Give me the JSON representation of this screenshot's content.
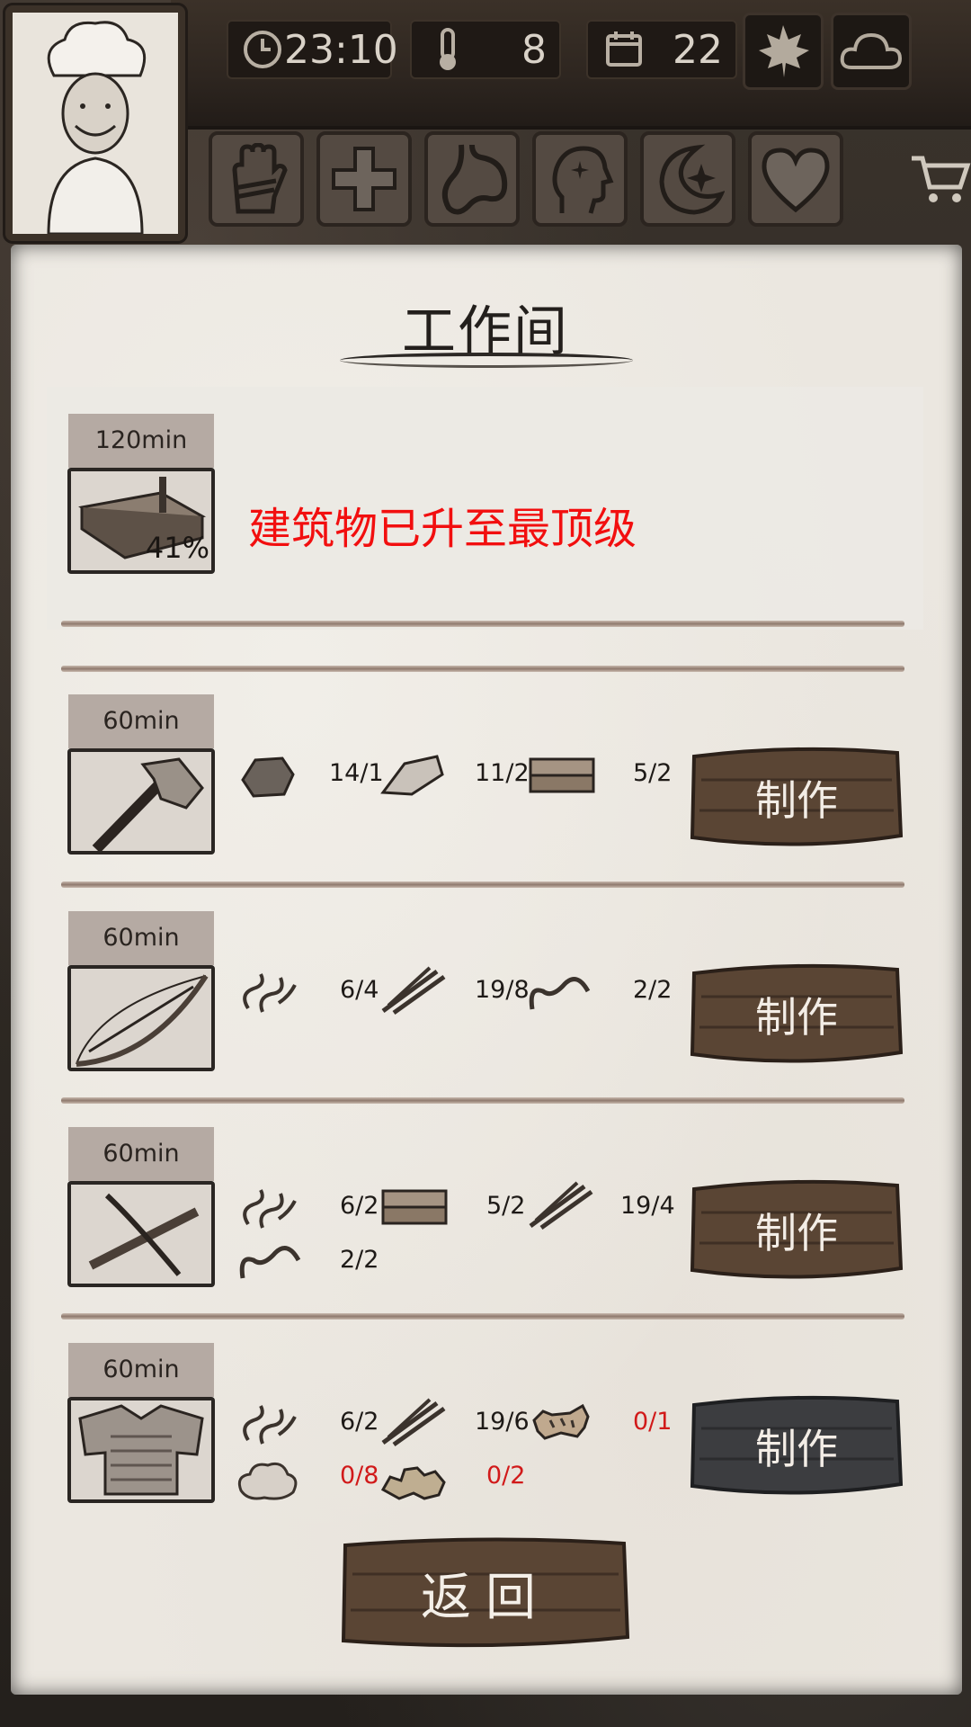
{
  "header": {
    "time": "23:10",
    "temperature": "8",
    "day": "22"
  },
  "stats": [
    "hand-bandage-icon",
    "health-cross-icon",
    "stomach-icon",
    "mind-icon",
    "sleep-moon-icon",
    "heart-icon"
  ],
  "panel": {
    "title": "工作间",
    "notice": "建筑物已升至最顶级"
  },
  "upgrade": {
    "time": "120min",
    "progress": "41%"
  },
  "recipes": [
    {
      "time": "60min",
      "item": "stone-axe",
      "reqs": [
        {
          "icon": "stone-icon",
          "count": "14/1"
        },
        {
          "icon": "flint-icon",
          "count": "11/2"
        },
        {
          "icon": "wood-plank-icon",
          "count": "5/2"
        }
      ],
      "button": "制作"
    },
    {
      "time": "60min",
      "item": "bow",
      "reqs": [
        {
          "icon": "rope-icon",
          "count": "6/4"
        },
        {
          "icon": "sticks-icon",
          "count": "19/8"
        },
        {
          "icon": "sinew-icon",
          "count": "2/2"
        }
      ],
      "button": "制作"
    },
    {
      "time": "60min",
      "item": "crossbow",
      "reqs": [
        {
          "icon": "rope-icon",
          "count": "6/2"
        },
        {
          "icon": "wood-plank-icon",
          "count": "5/2"
        },
        {
          "icon": "sticks-icon",
          "count": "19/4"
        },
        {
          "icon": "sinew-icon",
          "count": "2/2"
        }
      ],
      "button": "制作"
    },
    {
      "time": "60min",
      "item": "armor-vest",
      "reqs": [
        {
          "icon": "rope-icon",
          "count": "6/2"
        },
        {
          "icon": "sticks-icon",
          "count": "19/6"
        },
        {
          "icon": "animal-hide-icon",
          "count": "0/1"
        },
        {
          "icon": "cotton-icon",
          "count": "0/8"
        },
        {
          "icon": "ore-icon",
          "count": "0/2"
        }
      ],
      "button": "制作"
    }
  ],
  "back_button": "返回"
}
